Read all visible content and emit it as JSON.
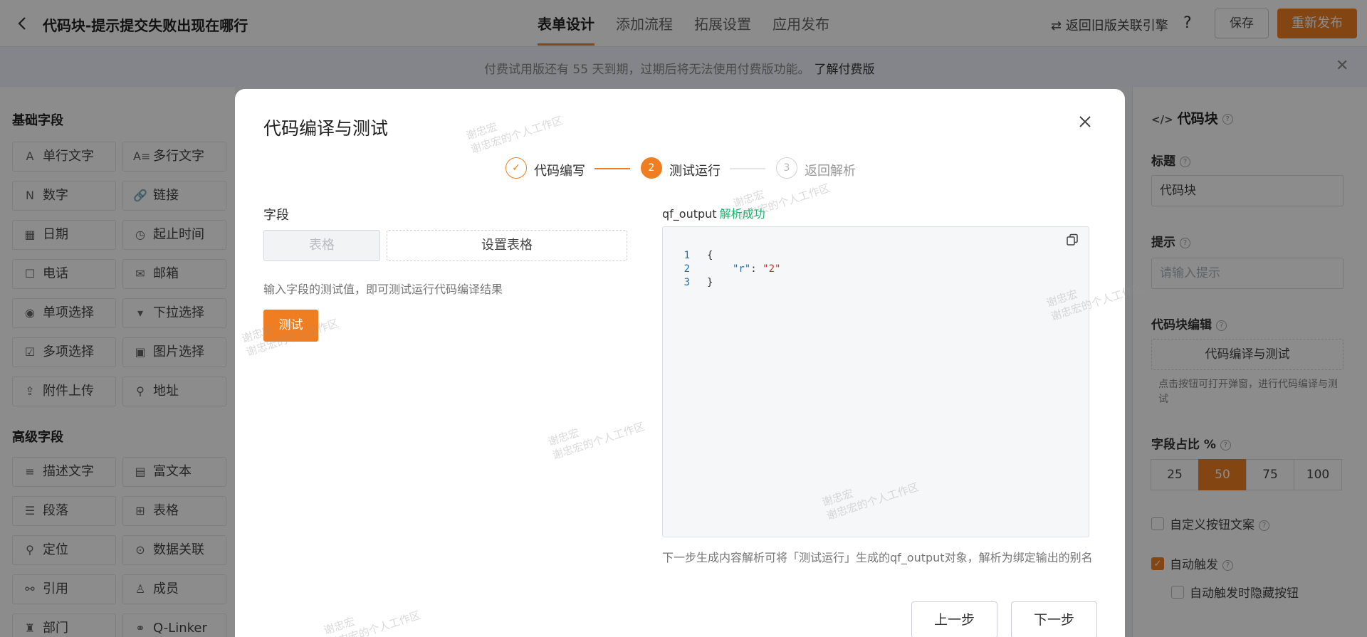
{
  "header": {
    "title": "代码块-提示提交失败出现在哪行",
    "tabs": [
      {
        "label": "表单设计"
      },
      {
        "label": "添加流程"
      },
      {
        "label": "拓展设置"
      },
      {
        "label": "应用发布"
      }
    ],
    "switch_engine": "⇄ 返回旧版关联引擎",
    "help": "?",
    "save": "保存",
    "publish": "重新发布"
  },
  "banner": {
    "text": "付费试用版还有 55 天到期，过期后将无法使用付费版功能。",
    "link": "了解付费版"
  },
  "sidebar": {
    "basic_title": "基础字段",
    "basic_fields": [
      {
        "label": "单行文字",
        "icon": "A"
      },
      {
        "label": "多行文字",
        "icon": "A≡"
      },
      {
        "label": "数字",
        "icon": "N"
      },
      {
        "label": "链接",
        "icon": "🔗"
      },
      {
        "label": "日期",
        "icon": "▦"
      },
      {
        "label": "起止时间",
        "icon": "◷"
      },
      {
        "label": "电话",
        "icon": "☐"
      },
      {
        "label": "邮箱",
        "icon": "✉"
      },
      {
        "label": "单项选择",
        "icon": "◉"
      },
      {
        "label": "下拉选择",
        "icon": "▾"
      },
      {
        "label": "多项选择",
        "icon": "☑"
      },
      {
        "label": "图片选择",
        "icon": "▣"
      },
      {
        "label": "附件上传",
        "icon": "⇪"
      },
      {
        "label": "地址",
        "icon": "⚲"
      }
    ],
    "advanced_title": "高级字段",
    "advanced_fields": [
      {
        "label": "描述文字",
        "icon": "≡"
      },
      {
        "label": "富文本",
        "icon": "▤"
      },
      {
        "label": "段落",
        "icon": "☰"
      },
      {
        "label": "表格",
        "icon": "⊞"
      },
      {
        "label": "定位",
        "icon": "⚲"
      },
      {
        "label": "数据关联",
        "icon": "⊙"
      },
      {
        "label": "引用",
        "icon": "⚯"
      },
      {
        "label": "成员",
        "icon": "♙"
      },
      {
        "label": "部门",
        "icon": "♜"
      },
      {
        "label": "Q-Linker",
        "icon": "⚭"
      }
    ]
  },
  "right_panel": {
    "title": "代码块",
    "title_label": "标题",
    "title_value": "代码块",
    "hint_label": "提示",
    "hint_placeholder": "请输入提示",
    "code_edit_label": "代码块编辑",
    "code_edit_button": "代码编译与测试",
    "code_edit_hint": "点击按钮可打开弹窗，进行代码编译与测试",
    "width_label": "字段占比 %",
    "width_options": [
      "25",
      "50",
      "75",
      "100"
    ],
    "width_selected": "50",
    "custom_button_text": "自定义按钮文案",
    "auto_trigger": "自动触发",
    "hide_on_auto": "自动触发时隐藏按钮"
  },
  "modal": {
    "title": "代码编译与测试",
    "steps": [
      {
        "label": "代码编写",
        "status": "done",
        "mark": "✓"
      },
      {
        "label": "测试运行",
        "status": "active",
        "mark": "2"
      },
      {
        "label": "返回解析",
        "status": "pending",
        "mark": "3"
      }
    ],
    "field_label": "字段",
    "field_value": "表格",
    "set_table_button": "设置表格",
    "test_hint": "输入字段的测试值，即可测试运行代码编译结果",
    "test_button": "测试",
    "output_label": "qf_output",
    "output_status": "解析成功",
    "code_lines": [
      {
        "n": "1",
        "text": "{"
      },
      {
        "n": "2",
        "key": "\"r\"",
        "sep": ": ",
        "value": "\"2\""
      },
      {
        "n": "3",
        "text": "}"
      }
    ],
    "footer_hint": "下一步生成内容解析可将「测试运行」生成的qf_output对象，解析为绑定输出的别名",
    "prev_button": "上一步",
    "next_button": "下一步"
  },
  "watermark": {
    "line1": "谢忠宏",
    "line2": "谢忠宏的个人工作区"
  },
  "colors": {
    "accent": "#ef7e22",
    "success": "#19b36b"
  }
}
